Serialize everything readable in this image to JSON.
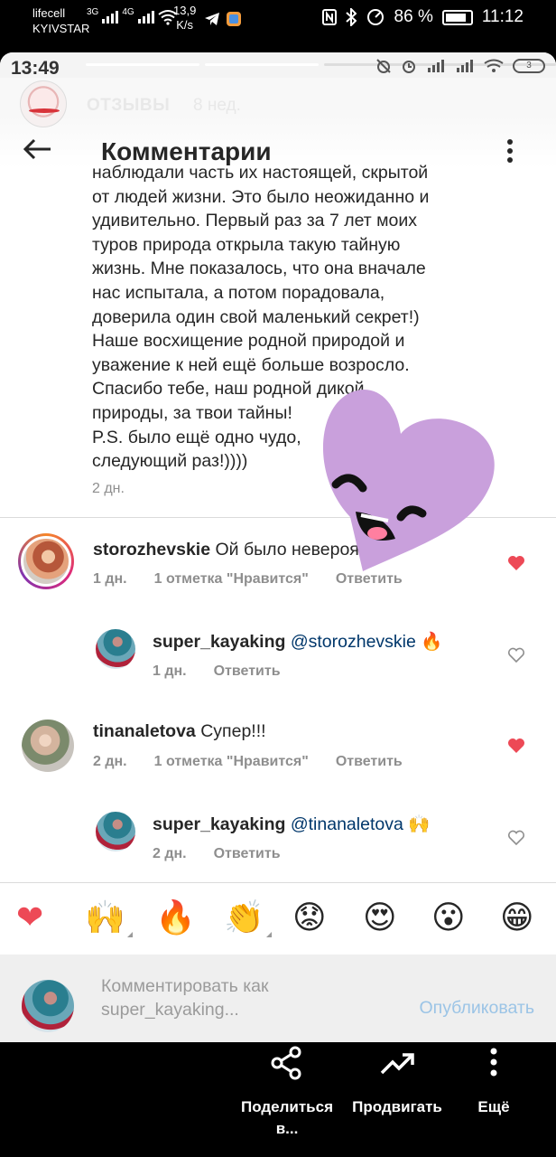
{
  "outer_status": {
    "carrier_top": "lifecell",
    "carrier_bottom": "KYIVSTAR",
    "net1": "3G",
    "net2": "4G",
    "speed_value": "13,9",
    "speed_unit": "K/s",
    "battery_percent": "86 %",
    "time": "11:12"
  },
  "inner_status": {
    "time": "13:49",
    "battery": "3"
  },
  "story": {
    "title": "ОТЗЫВЫ",
    "age": "8 нед."
  },
  "header": {
    "title": "Комментарии"
  },
  "caption": {
    "lines": [
      "наблюдали часть их настоящей, скрытой",
      "от людей жизни. Это было неожиданно и",
      "удивительно. Первый раз за 7 лет моих",
      "туров природа открыла такую тайную",
      "жизнь. Мне показалось, что она вначале",
      "нас испытала, а потом порадовала,",
      "доверила один свой маленький секрет!)",
      "Наше восхищение родной природой и",
      "уважение к ней ещё больше возросло.",
      "Спасибо тебе, наш родной дикой",
      "природы, за твои тайны!",
      "P.S. было ещё одно чудо,",
      "следующий раз!))))"
    ],
    "time": "2 дн."
  },
  "comments": [
    {
      "user": "storozhevskie",
      "text": " Ой было невероятно!₽",
      "time": "1 дн.",
      "likes": "1 отметка \"Нравится\"",
      "reply": "Ответить"
    },
    {
      "user": "super_kayaking",
      "mention": " @storozhevskie",
      "emoji": " 🔥",
      "time": "1 дн.",
      "reply": "Ответить"
    },
    {
      "user": "tinanaletova",
      "text": " Супер!!!",
      "time": "2 дн.",
      "likes": "1 отметка \"Нравится\"",
      "reply": "Ответить"
    },
    {
      "user": "super_kayaking",
      "mention": " @tinanaletova",
      "emoji": " 🙌",
      "time": "2 дн.",
      "reply": "Ответить"
    }
  ],
  "reactions": [
    "❤",
    "🙌",
    "🔥",
    "👏",
    "😟",
    "😍",
    "😮",
    "😁"
  ],
  "compose": {
    "placeholder_line1": "Комментировать как",
    "placeholder_line2": "super_kayaking...",
    "publish": "Опубликовать"
  },
  "actions": {
    "share_line1": "Поделиться",
    "share_line2": "в...",
    "promote": "Продвигать",
    "more": "Ещё"
  },
  "colors": {
    "like_red": "#ed4956",
    "link_blue": "#00376b",
    "publish_blue": "#9bc4e6",
    "sticker_purple": "#c9a0dc"
  }
}
